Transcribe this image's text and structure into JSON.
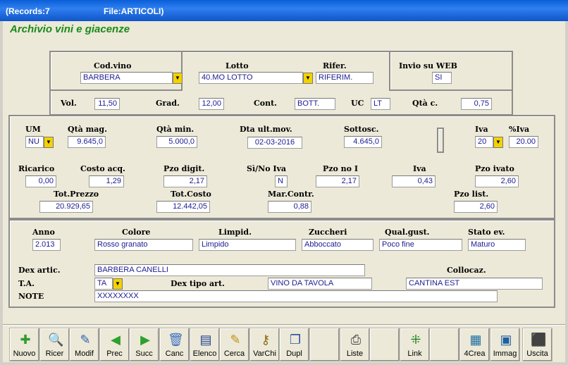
{
  "titlebar": {
    "records": "(Records:7",
    "file": "File:ARTICOLI)"
  },
  "heading": "Archivio vini e giacenze",
  "top": {
    "cod_vino_label": "Cod.vino",
    "cod_vino": "BARBERA",
    "lotto_label": "Lotto",
    "lotto": "40.MO LOTTO",
    "rifer_label": "Rifer.",
    "rifer": "RIFERIM.",
    "web_label": "Invio su WEB",
    "web": "SI",
    "vol_label": "Vol.",
    "vol": "11,50",
    "grad_label": "Grad.",
    "grad": "12,00",
    "cont_label": "Cont.",
    "cont": "BOTT.",
    "uc_label": "UC",
    "uc": "LT",
    "qtac_label": "Qtà c.",
    "qtac": "0,75"
  },
  "mid": {
    "um_label": "UM",
    "um": "NU",
    "qtamag_label": "Qtà mag.",
    "qtamag": "9.645,0",
    "qtamin_label": "Qtà min.",
    "qtamin": "5.000,0",
    "dta_label": "Dta ult.mov.",
    "dta": "02-03-2016",
    "sottosc_label": "Sottosc.",
    "sottosc": "4.645,0",
    "iva_label": "Iva",
    "iva": "20",
    "piva_label": "%Iva",
    "piva": "20.00",
    "ricarico_label": "Ricarico",
    "ricarico": "0,00",
    "costo_label": "Costo acq.",
    "costo": "1,29",
    "pzodig_label": "Pzo digit.",
    "pzodig": "2,17",
    "sino_label": "Sì/No Iva",
    "sino": "N",
    "pzonoi_label": "Pzo no I",
    "pzonoi": "2,17",
    "iva2_label": "Iva",
    "iva2": "0,43",
    "pzoiv_label": "Pzo ivato",
    "pzoiv": "2,60",
    "totprezzo_label": "Tot.Prezzo",
    "totprezzo": "20.929,65",
    "totcosto_label": "Tot.Costo",
    "totcosto": "12.442,05",
    "marcontr_label": "Mar.Contr.",
    "marcontr": "0,88",
    "pzolist_label": "Pzo list.",
    "pzolist": "2,60"
  },
  "bottom": {
    "anno_label": "Anno",
    "anno": "2.013",
    "colore_label": "Colore",
    "colore": "Rosso granato",
    "limpid_label": "Limpid.",
    "limpid": "Limpido",
    "zuccheri_label": "Zuccheri",
    "zuccheri": "Abboccato",
    "qual_label": "Qual.gust.",
    "qual": "Poco fine",
    "stato_label": "Stato ev.",
    "stato": "Maturo",
    "dex_label": "Dex artic.",
    "dex": "BARBERA CANELLI",
    "colloc_label": "Collocaz.",
    "colloc": "CANTINA EST",
    "ta_label": "T.A.",
    "ta": "TA",
    "dextipo_label": "Dex tipo art.",
    "dextipo": "VINO DA TAVOLA",
    "note_label": "NOTE",
    "note": "XXXXXXXX"
  },
  "toolbar": [
    {
      "label": "Nuovo",
      "icon": "new-record-icon",
      "glyph": "✚",
      "color": "#2e9b2e"
    },
    {
      "label": "Ricer",
      "icon": "search-icon",
      "glyph": "🔍",
      "color": "#2f5fb0"
    },
    {
      "label": "Modif",
      "icon": "edit-icon",
      "glyph": "✎",
      "color": "#2f5fb0"
    },
    {
      "label": "Prec",
      "icon": "arrow-left-icon",
      "glyph": "◀",
      "color": "#2ea02e"
    },
    {
      "label": "Succ",
      "icon": "arrow-right-icon",
      "glyph": "▶",
      "color": "#2ea02e"
    },
    {
      "label": "Canc",
      "icon": "trash-icon",
      "glyph": "🗑",
      "color": "#3c6fc0"
    },
    {
      "label": "Elenco",
      "icon": "list-icon",
      "glyph": "▤",
      "color": "#1f3f8f"
    },
    {
      "label": "Cerca",
      "icon": "find-icon",
      "glyph": "✎",
      "color": "#c09010"
    },
    {
      "label": "VarChi",
      "icon": "keys-icon",
      "glyph": "⚷",
      "color": "#8a6a10"
    },
    {
      "label": "Dupl",
      "icon": "duplicate-icon",
      "glyph": "❐",
      "color": "#3050a0"
    },
    {
      "label": "",
      "icon": "empty-icon",
      "glyph": "",
      "color": "#000"
    },
    {
      "label": "Liste",
      "icon": "printer-icon",
      "glyph": "⎙",
      "color": "#404040"
    },
    {
      "label": "",
      "icon": "empty-icon",
      "glyph": "",
      "color": "#000"
    },
    {
      "label": "Link",
      "icon": "link-icon",
      "glyph": "⁜",
      "color": "#208020"
    },
    {
      "label": "",
      "icon": "empty-icon",
      "glyph": "",
      "color": "#000"
    },
    {
      "label": "4Crea",
      "icon": "create-icon",
      "glyph": "▦",
      "color": "#1f6f9f"
    },
    {
      "label": "Immag",
      "icon": "image-icon",
      "glyph": "▣",
      "color": "#2060a0"
    },
    {
      "label": "Uscita",
      "icon": "exit-icon",
      "glyph": "⬛",
      "color": "#c01010"
    }
  ],
  "colors": {
    "heading": "#1b8a1b",
    "field_text": "#1c1c90",
    "dropdown": "#f3d200"
  }
}
